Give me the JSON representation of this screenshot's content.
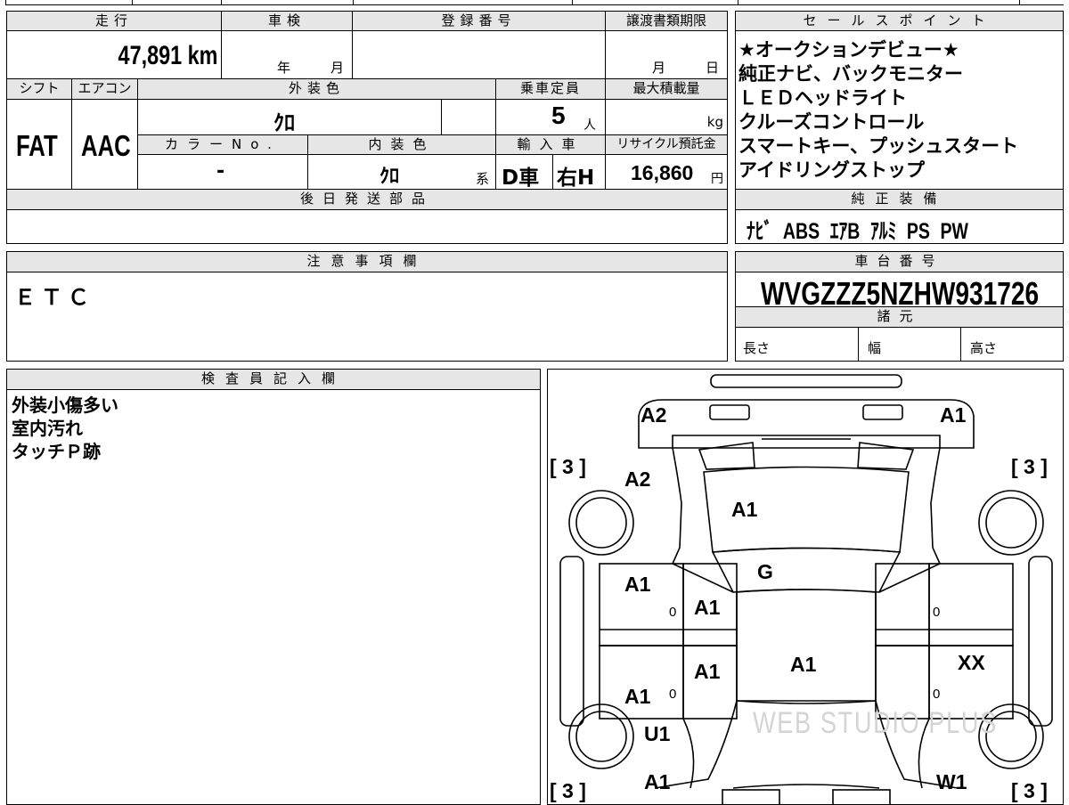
{
  "fields": {
    "mileage_label": "走行",
    "mileage_value": "47,891 km",
    "inspection_label": "車検",
    "inspection_year": "年",
    "inspection_month": "月",
    "registration_label": "登録番号",
    "transfer_label": "譲渡書類期限",
    "transfer_month": "月",
    "transfer_day": "日",
    "shift_label": "シフト",
    "shift_value": "FAT",
    "aircon_label": "エアコン",
    "aircon_value": "AAC",
    "exterior_label": "外装色",
    "exterior_value": "ｸﾛ",
    "capacity_label": "乗車定員",
    "capacity_value": "5",
    "capacity_unit": "人",
    "maxload_label": "最大積載量",
    "maxload_unit": "kg",
    "colorno_label": "カラーNo.",
    "colorno_value": "-",
    "interior_label": "内装色",
    "interior_value": "ｸﾛ",
    "interior_suffix": "系",
    "import_label": "輸入車",
    "import_d": "D車",
    "import_h": "右H",
    "recycle_label": "リサイクル預託金",
    "recycle_value": "16,860",
    "recycle_unit": "円",
    "later_parts_label": "後日発送部品"
  },
  "sales": {
    "label": "セールスポイント",
    "lines": [
      "★オークションデビュー★",
      "純正ナビ、バックモニター",
      "ＬＥＤヘッドライト",
      "クルーズコントロール",
      "スマートキー、プッシュスタート",
      "アイドリングストップ"
    ]
  },
  "equipment": {
    "label": "純正装備",
    "value": "ﾅﾋﾞ ABS ｴｱB ｱﾙﾐ PS PW"
  },
  "notice": {
    "label": "注意事項欄",
    "text": "ＥＴＣ"
  },
  "chassis": {
    "label": "車台番号",
    "value": "WVGZZZ5NZHW931726"
  },
  "specs": {
    "label": "諸元",
    "length": "長さ",
    "width": "幅",
    "height": "高さ"
  },
  "inspector": {
    "label": "検査員記入欄",
    "lines": [
      "外装小傷多い",
      "室内汚れ",
      "タッチＰ跡"
    ]
  },
  "diagram": {
    "tire_fl": "[ 3 ]",
    "tire_fr": "[ 3 ]",
    "tire_rl": "[ 3 ]",
    "tire_rr": "[ 3 ]",
    "front_bumper_left": "A2",
    "front_bumper_right": "A1",
    "left_front_fender": "A2",
    "hood": "A1",
    "windshield": "G",
    "left_front_door": "A1",
    "left_front_door_inner": "A1",
    "left_rear_door_inner": "A1",
    "left_rear_door": "A1",
    "roof": "A1",
    "right_rear_door": "XX",
    "left_rear_wheel_arch": "U1",
    "left_rear_quarter": "A1",
    "right_rear_quarter": "W1",
    "zero_marks": [
      "0",
      "0",
      "0",
      "0"
    ],
    "watermark": "WEB STUDIO PLUS"
  }
}
